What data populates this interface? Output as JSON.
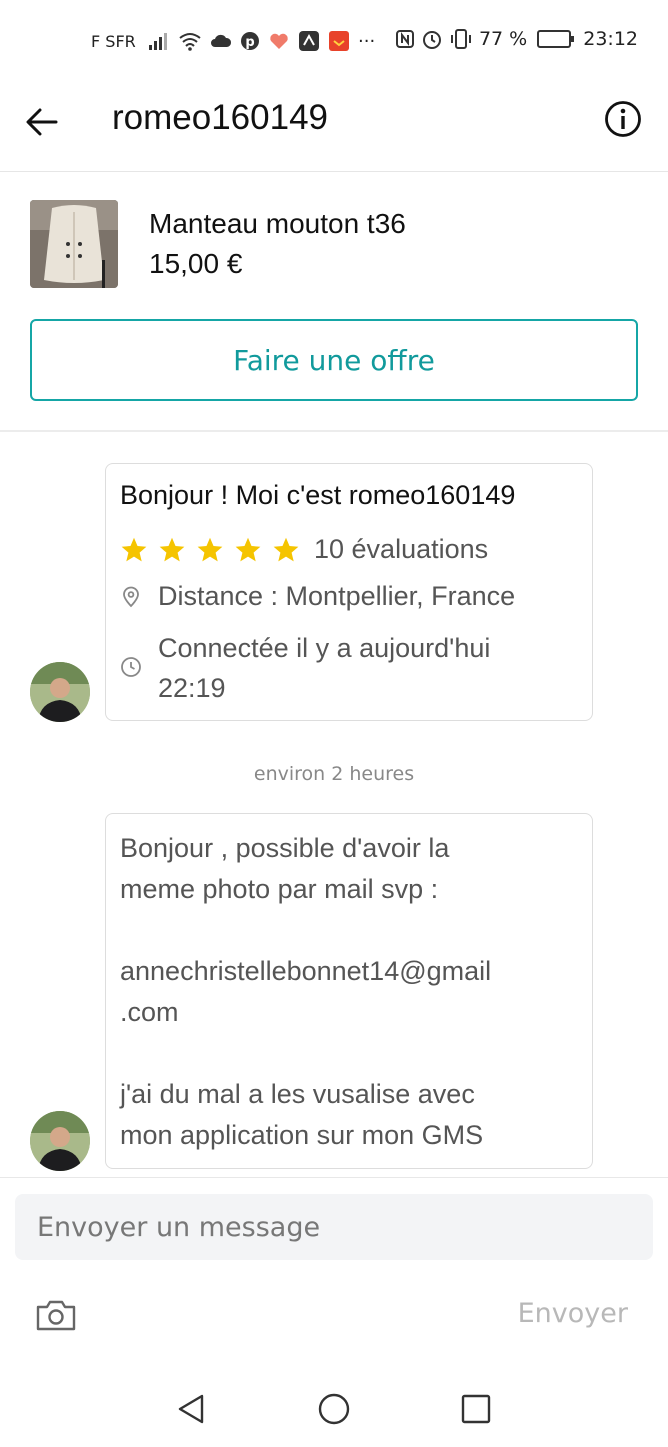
{
  "status_bar": {
    "carrier": "F SFR",
    "overflow": "···",
    "battery_text": "77 %",
    "battery_level": 0.77,
    "time": "23:12"
  },
  "header": {
    "title": "romeo160149",
    "back_icon": "arrow-left-icon",
    "info_icon": "info-circle-icon"
  },
  "item": {
    "title": "Manteau mouton t36",
    "price": "15,00 €",
    "offer_label": "Faire une offre"
  },
  "chat": {
    "intro": {
      "greeting": "Bonjour ! Moi c'est romeo160149",
      "rating": 5,
      "reviews": "10 évaluations",
      "distance": "Distance : Montpellier, France",
      "connected_line1": "Connectée il y a aujourd'hui",
      "connected_line2": "22:19"
    },
    "timestamp": "environ 2 heures",
    "message": {
      "line1": "Bonjour , possible d'avoir la",
      "line2": "meme photo par mail svp :",
      "line3": "annechristellebonnet14@gmail",
      "line4": ".com",
      "line5": "j'ai du mal a les vusalise avec",
      "line6": "mon application sur mon GMS"
    }
  },
  "composer": {
    "placeholder": "Envoyer un message",
    "send_label": "Envoyer",
    "camera_icon": "camera-icon"
  },
  "colors": {
    "accent": "#119a9c",
    "star": "#f5c400",
    "muted": "#555555"
  }
}
